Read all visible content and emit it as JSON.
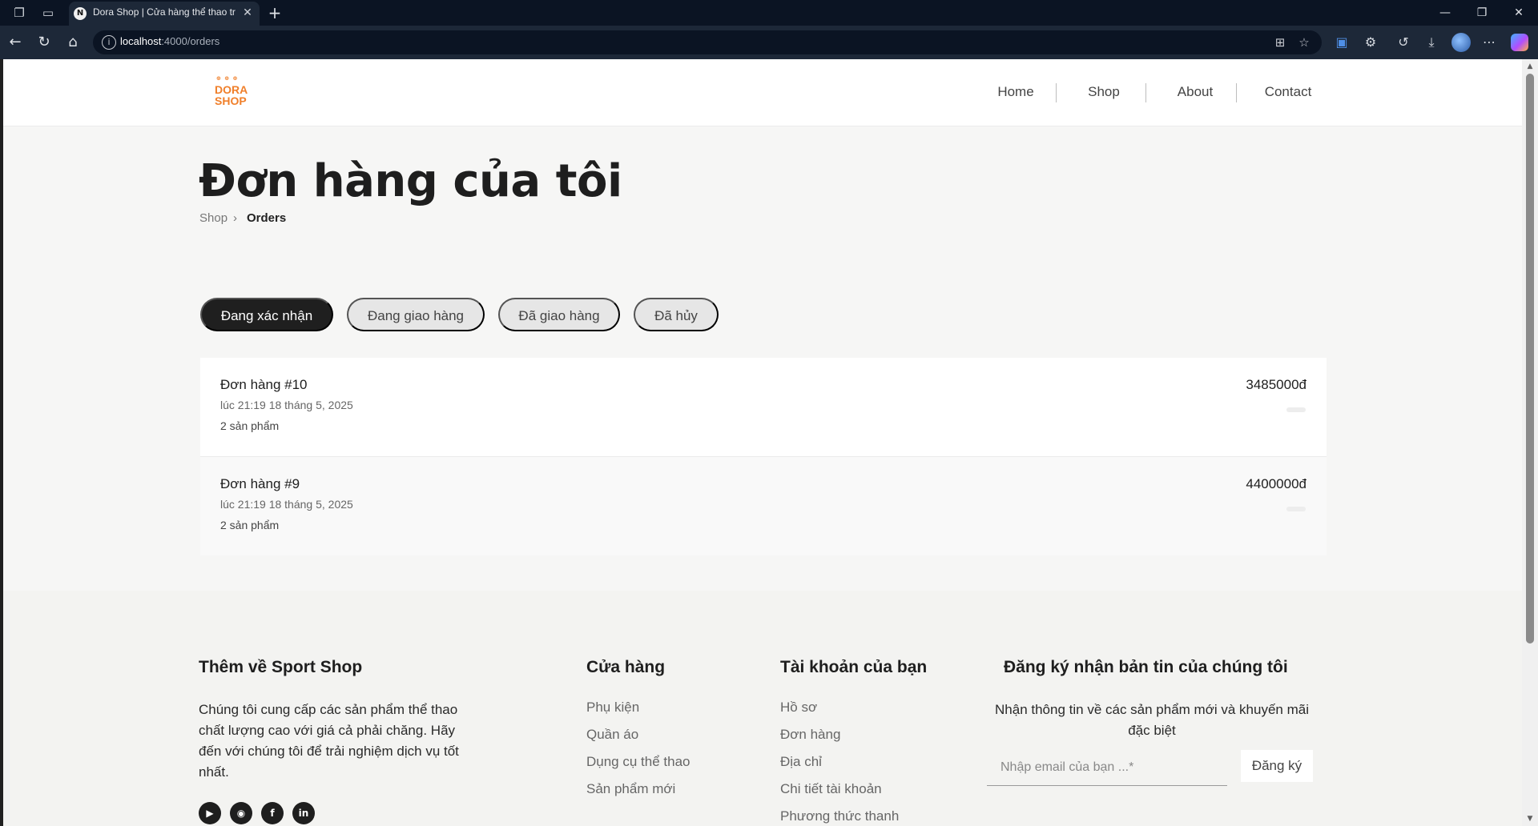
{
  "browser": {
    "tab_title": "Dora Shop | Cửa hàng thể thao trực tuyến",
    "tab_favicon": "N",
    "url_host": "localhost",
    "url_path": ":4000/orders",
    "icons": [
      "workspaces-icon",
      "tab-actions-icon",
      "close-icon",
      "new-tab-icon",
      "back-icon",
      "refresh-icon",
      "home-icon",
      "info-icon",
      "app-available-icon",
      "favorite-star-icon",
      "translate-icon",
      "extensions-icon",
      "history-icon",
      "downloads-icon",
      "profile-avatar-icon",
      "more-icon",
      "copilot-icon"
    ]
  },
  "site": {
    "logo_tagline": "⊕ ⊕ ⊕",
    "logo_line1": "DORA",
    "logo_line2": "SHOP",
    "accent_color": "#f07f2a",
    "nav": [
      "Home",
      "Shop",
      "About",
      "Contact"
    ]
  },
  "page": {
    "title": "Đơn hàng của tôi",
    "breadcrumb": [
      "Shop",
      "Orders"
    ],
    "breadcrumb_sep": "›"
  },
  "status_tabs": [
    {
      "label": "Đang xác nhận",
      "active": true
    },
    {
      "label": "Đang giao hàng",
      "active": false
    },
    {
      "label": "Đã giao hàng",
      "active": false
    },
    {
      "label": "Đã hủy",
      "active": false
    }
  ],
  "orders": [
    {
      "title": "Đơn hàng #10",
      "date": "lúc 21:19 18 tháng 5, 2025",
      "count": "2 sản phẩm",
      "total": "3485000đ"
    },
    {
      "title": "Đơn hàng #9",
      "date": "lúc 21:19 18 tháng 5, 2025",
      "count": "2 sản phẩm",
      "total": "4400000đ"
    }
  ],
  "footer": {
    "about_heading": "Thêm về Sport Shop",
    "about_text": "Chúng tôi cung cấp các sản phẩm thể thao chất lượng cao với giá cả phải chăng. Hãy đến với chúng tôi để trải nghiệm dịch vụ tốt nhất.",
    "social": [
      "youtube-icon",
      "github-icon",
      "facebook-icon",
      "linkedin-icon"
    ],
    "shop_heading": "Cửa hàng",
    "shop_links": [
      "Phụ kiện",
      "Quần áo",
      "Dụng cụ thể thao",
      "Sản phẩm mới"
    ],
    "account_heading": "Tài khoản của bạn",
    "account_links": [
      "Hồ sơ",
      "Đơn hàng",
      "Địa chỉ",
      "Chi tiết tài khoản",
      "Phương thức thanh"
    ],
    "news_heading": "Đăng ký nhận bản tin của chúng tôi",
    "news_desc": "Nhận thông tin về các sản phẩm mới và khuyến mãi đặc biệt",
    "email_placeholder": "Nhập email của bạn ...*",
    "subscribe_label": "Đăng ký"
  }
}
